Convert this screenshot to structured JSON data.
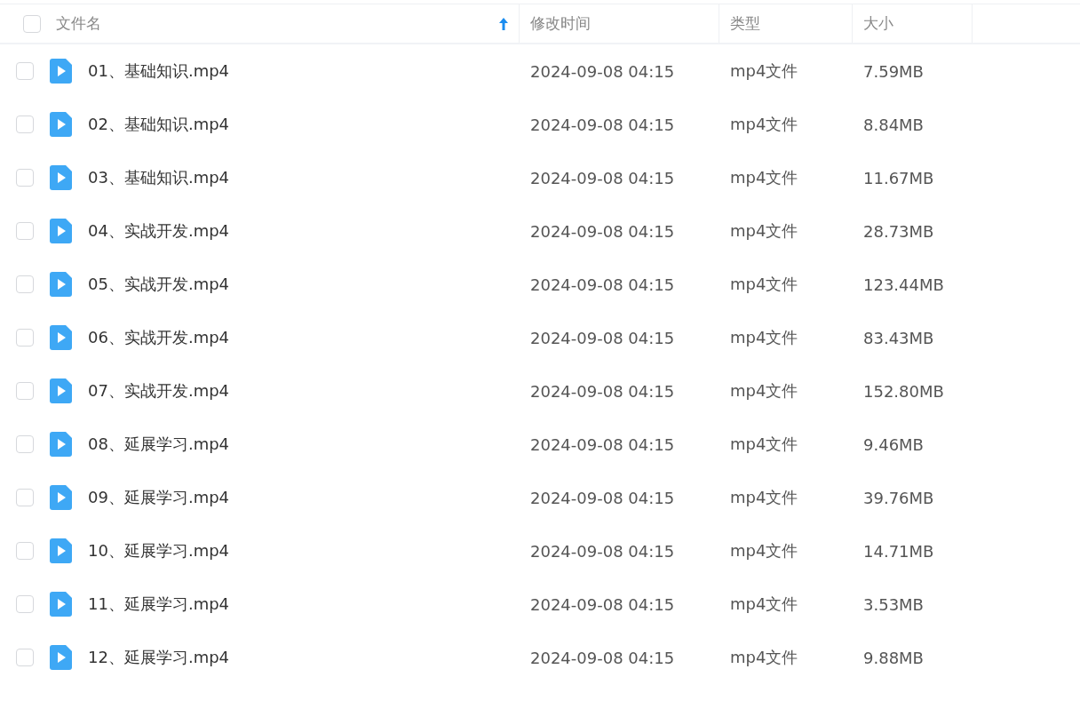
{
  "header": {
    "checked": false,
    "columns": [
      {
        "label": "文件名",
        "sorted": true
      },
      {
        "label": "修改时间",
        "sorted": false
      },
      {
        "label": "类型",
        "sorted": false
      },
      {
        "label": "大小",
        "sorted": false
      }
    ]
  },
  "rows": [
    {
      "checked": false,
      "name": "01、基础知识.mp4",
      "modified": "2024-09-08 04:15",
      "type": "mp4文件",
      "size": "7.59MB"
    },
    {
      "checked": false,
      "name": "02、基础知识.mp4",
      "modified": "2024-09-08 04:15",
      "type": "mp4文件",
      "size": "8.84MB"
    },
    {
      "checked": false,
      "name": "03、基础知识.mp4",
      "modified": "2024-09-08 04:15",
      "type": "mp4文件",
      "size": "11.67MB"
    },
    {
      "checked": false,
      "name": "04、实战开发.mp4",
      "modified": "2024-09-08 04:15",
      "type": "mp4文件",
      "size": "28.73MB"
    },
    {
      "checked": false,
      "name": "05、实战开发.mp4",
      "modified": "2024-09-08 04:15",
      "type": "mp4文件",
      "size": "123.44MB"
    },
    {
      "checked": false,
      "name": "06、实战开发.mp4",
      "modified": "2024-09-08 04:15",
      "type": "mp4文件",
      "size": "83.43MB"
    },
    {
      "checked": false,
      "name": "07、实战开发.mp4",
      "modified": "2024-09-08 04:15",
      "type": "mp4文件",
      "size": "152.80MB"
    },
    {
      "checked": false,
      "name": "08、延展学习.mp4",
      "modified": "2024-09-08 04:15",
      "type": "mp4文件",
      "size": "9.46MB"
    },
    {
      "checked": false,
      "name": "09、延展学习.mp4",
      "modified": "2024-09-08 04:15",
      "type": "mp4文件",
      "size": "39.76MB"
    },
    {
      "checked": false,
      "name": "10、延展学习.mp4",
      "modified": "2024-09-08 04:15",
      "type": "mp4文件",
      "size": "14.71MB"
    },
    {
      "checked": false,
      "name": "11、延展学习.mp4",
      "modified": "2024-09-08 04:15",
      "type": "mp4文件",
      "size": "3.53MB"
    },
    {
      "checked": false,
      "name": "12、延展学习.mp4",
      "modified": "2024-09-08 04:15",
      "type": "mp4文件",
      "size": "9.88MB"
    }
  ]
}
